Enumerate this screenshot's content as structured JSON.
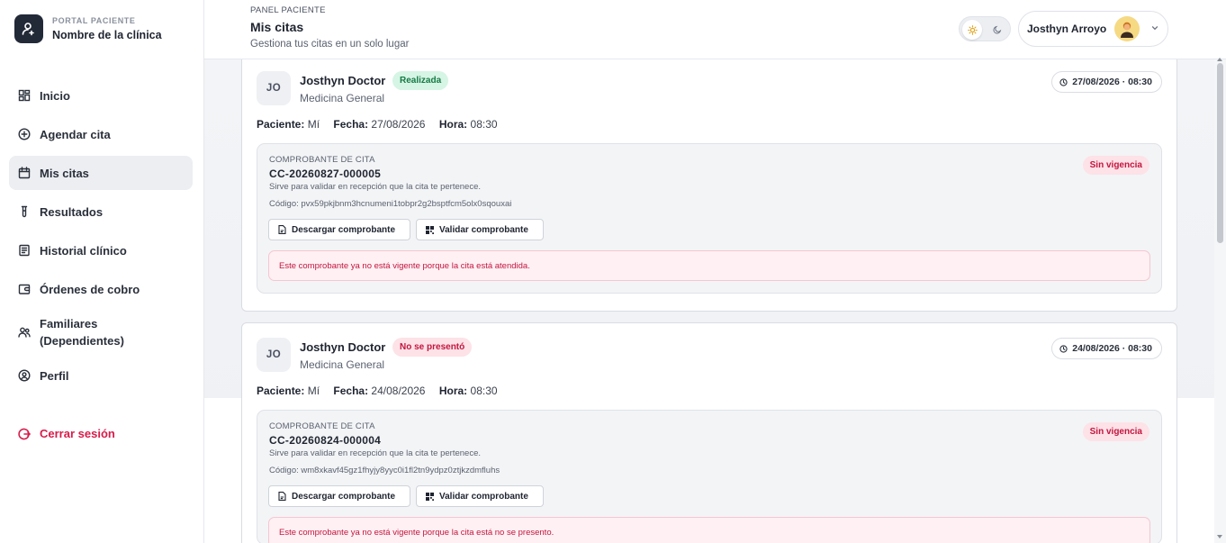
{
  "brand": {
    "eyebrow": "PORTAL PACIENTE",
    "name": "Nombre de la clínica"
  },
  "sidebar": {
    "items": [
      {
        "label": "Inicio",
        "icon": "dashboard-icon",
        "active": false
      },
      {
        "label": "Agendar cita",
        "icon": "plus-circle-icon",
        "active": false
      },
      {
        "label": "Mis citas",
        "icon": "calendar-icon",
        "active": true
      },
      {
        "label": "Resultados",
        "icon": "test-tube-icon",
        "active": false
      },
      {
        "label": "Historial clínico",
        "icon": "file-list-icon",
        "active": false
      },
      {
        "label": "Órdenes de cobro",
        "icon": "wallet-icon",
        "active": false
      },
      {
        "label": "Familiares\n(Dependientes)",
        "icon": "users-icon",
        "active": false
      },
      {
        "label": "Perfil",
        "icon": "user-circle-icon",
        "active": false
      }
    ],
    "logout": "Cerrar sesión"
  },
  "header": {
    "eyebrow": "PANEL PACIENTE",
    "title": "Mis citas",
    "subtitle": "Gestiona tus citas en un solo lugar",
    "user_name": "Josthyn Arroyo"
  },
  "labels": {
    "paciente": "Paciente:",
    "fecha": "Fecha:",
    "hora": "Hora:",
    "voucher_eyebrow": "COMPROBANTE DE CITA",
    "voucher_desc": "Sirve para validar en recepción que la cita te pertenece.",
    "download": "Descargar comprobante",
    "validate": "Validar comprobante"
  },
  "appointments": [
    {
      "initials": "JO",
      "doctor": "Josthyn Doctor",
      "status": "Realizada",
      "specialty": "Medicina General",
      "datetime": "27/08/2026 · 08:30",
      "patient": "Mí",
      "date": "27/08/2026",
      "time": "08:30",
      "voucher_code": "CC-20260827-000005",
      "voucher_hash": "Código: pvx59pkjbnm3hcnumeni1tobpr2g2bsptfcm5olx0sqouxai",
      "voucher_status": "Sin vigencia",
      "alert": "Este comprobante ya no está vigente porque la cita está atendida."
    },
    {
      "initials": "JO",
      "doctor": "Josthyn Doctor",
      "status": "No se presentó",
      "specialty": "Medicina General",
      "datetime": "24/08/2026 · 08:30",
      "patient": "Mí",
      "date": "24/08/2026",
      "time": "08:30",
      "voucher_code": "CC-20260824-000004",
      "voucher_hash": "Código: wm8xkavf45gz1fhyjy8yyc0i1fl2tn9ydpz0ztjkzdmfluhs",
      "voucher_status": "Sin vigencia",
      "alert": "Este comprobante ya no está vigente porque la cita está no se presento."
    }
  ],
  "colors": {
    "accent_dark": "#222a38",
    "success_bg": "#d6f5e4",
    "success_fg": "#157a45",
    "danger_bg": "#fde2e7",
    "danger_fg": "#c2163f"
  }
}
